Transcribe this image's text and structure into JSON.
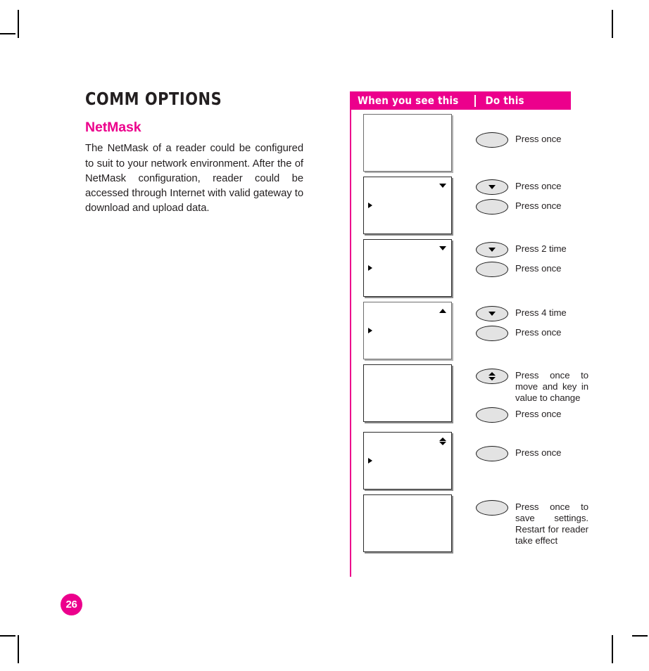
{
  "page": {
    "number": "26",
    "chapter_title": "COMM OPTIONS",
    "section_title": "NetMask",
    "body_text": "The NetMask of a reader could be configured to suit to your network environment. After the of NetMask configuration, reader could be accessed through Internet with valid gateway to download and upload data.",
    "accent_color": "#ec008c",
    "text_color": "#231f20"
  },
  "table": {
    "header": {
      "when_label": "When you see this",
      "do_label": "Do this"
    },
    "rows": [
      {
        "screen": {
          "corner_indicator": "none",
          "left_indicator": "none",
          "style": "soft"
        },
        "actions": [
          {
            "button_glyph": "blank",
            "text": "Press once",
            "wrap": false
          }
        ]
      },
      {
        "screen": {
          "corner_indicator": "down-triangle",
          "left_indicator": "right-triangle",
          "style": "hard"
        },
        "actions": [
          {
            "button_glyph": "down-arrow",
            "text": "Press once",
            "wrap": false
          },
          {
            "button_glyph": "blank",
            "text": "Press once",
            "wrap": false
          }
        ]
      },
      {
        "screen": {
          "corner_indicator": "down-triangle",
          "left_indicator": "right-triangle",
          "style": "hard"
        },
        "actions": [
          {
            "button_glyph": "down-arrow",
            "text": "Press 2 time",
            "wrap": false
          },
          {
            "button_glyph": "blank",
            "text": "Press once",
            "wrap": false
          }
        ]
      },
      {
        "screen": {
          "corner_indicator": "up-triangle",
          "left_indicator": "right-triangle",
          "style": "soft"
        },
        "actions": [
          {
            "button_glyph": "down-arrow",
            "text": "Press 4 time",
            "wrap": false
          },
          {
            "button_glyph": "blank",
            "text": "Press once",
            "wrap": false
          }
        ]
      },
      {
        "screen": {
          "corner_indicator": "none",
          "left_indicator": "none",
          "style": "hard"
        },
        "actions": [
          {
            "button_glyph": "up-down-arrow",
            "text": "Press once to move and key in value to change",
            "wrap": true
          },
          {
            "button_glyph": "blank",
            "text": "Press once",
            "wrap": false
          }
        ]
      },
      {
        "screen": {
          "corner_indicator": "up-down-triangle",
          "left_indicator": "right-triangle",
          "style": "hard"
        },
        "actions": [
          {
            "button_glyph": "blank",
            "text": "Press once",
            "wrap": false
          }
        ]
      },
      {
        "screen": {
          "corner_indicator": "none",
          "left_indicator": "none",
          "style": "hard"
        },
        "actions": [
          {
            "button_glyph": "blank",
            "text": "Press once to save settings. Restart for reader take effect",
            "wrap": true
          }
        ]
      }
    ]
  }
}
